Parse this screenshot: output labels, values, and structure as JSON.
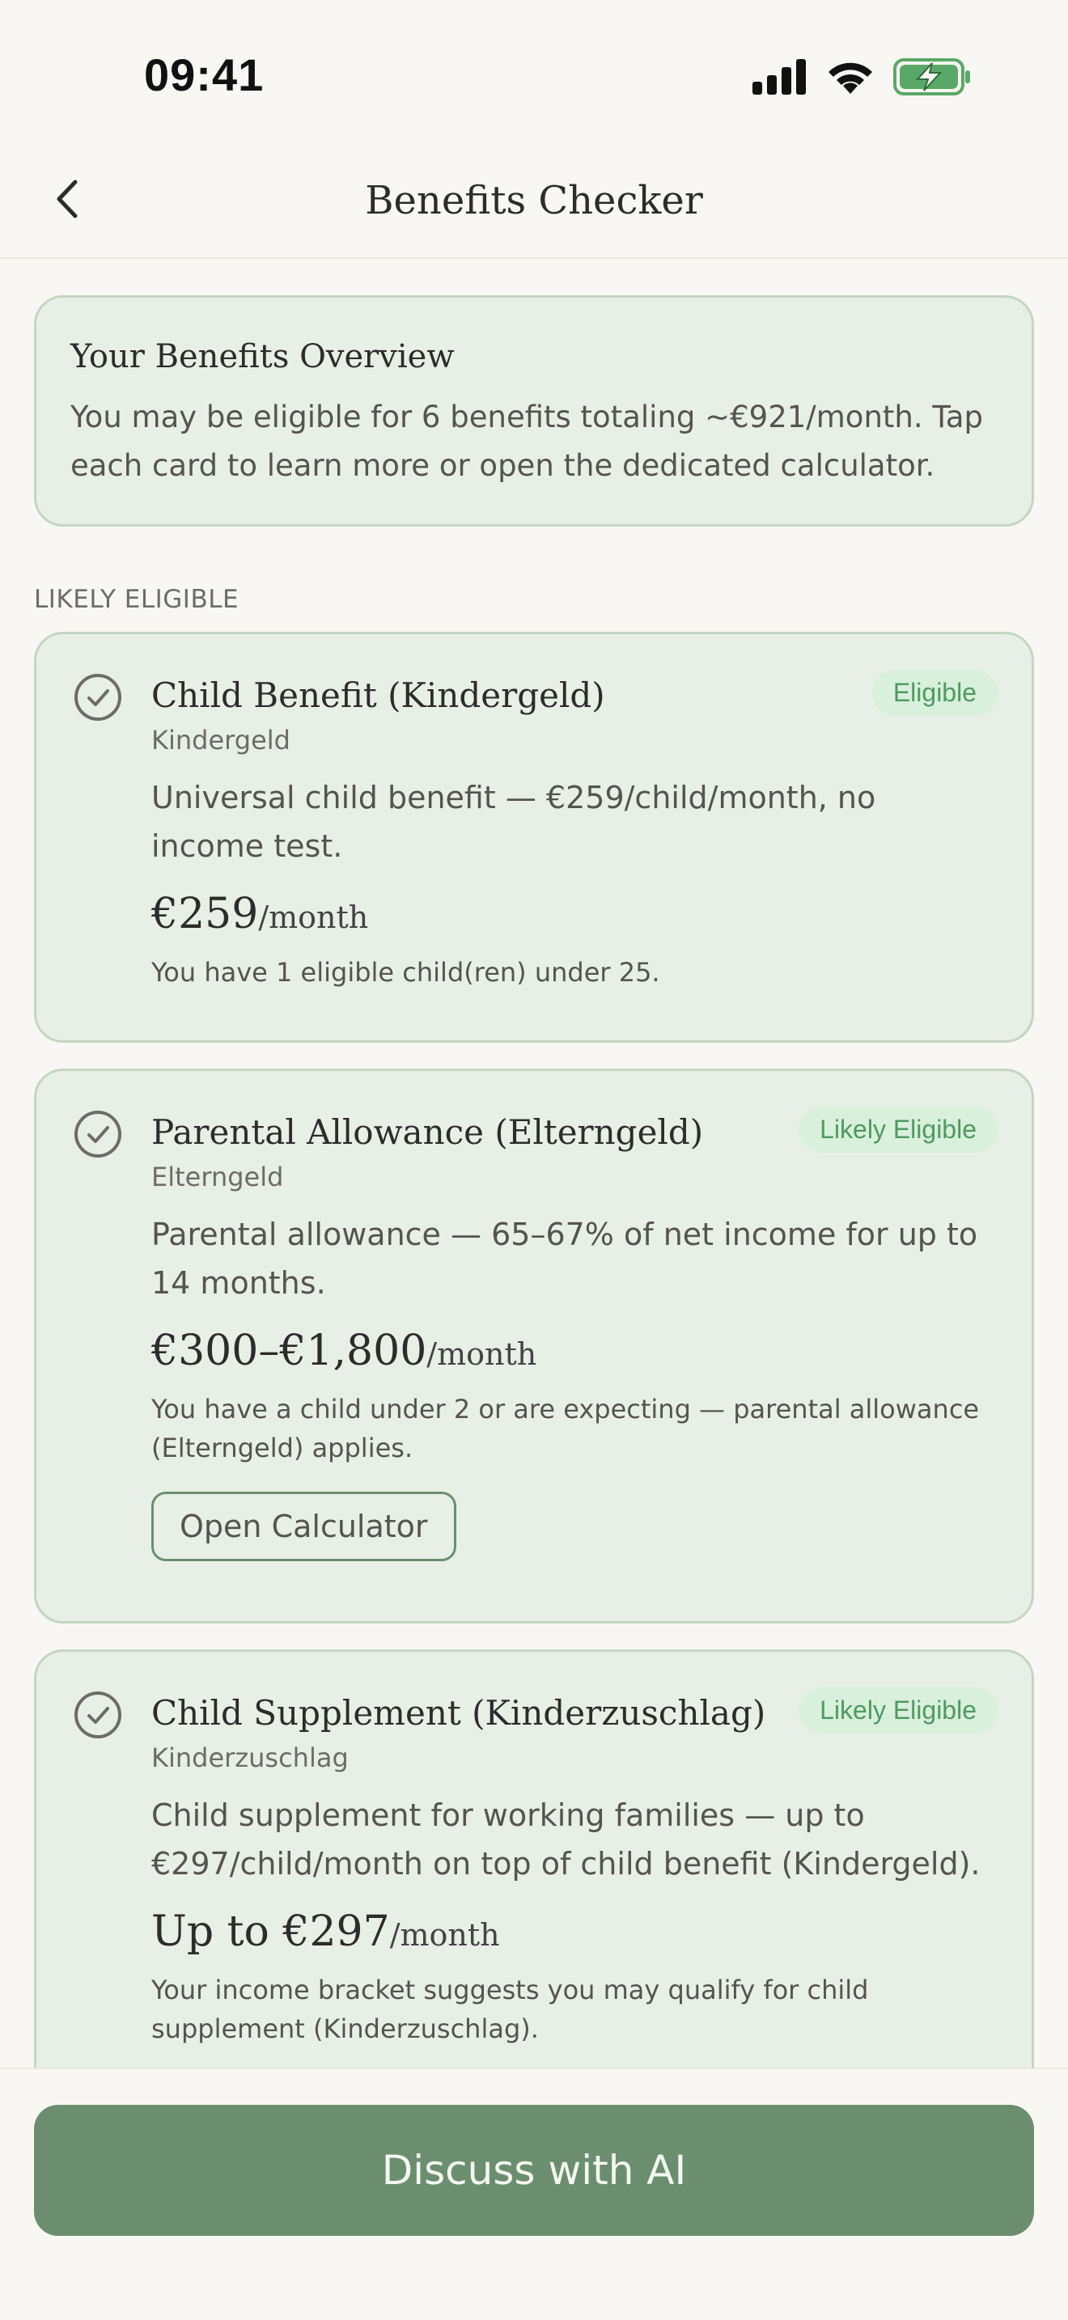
{
  "status": {
    "time": "09:41"
  },
  "nav": {
    "title": "Benefits Checker"
  },
  "overview": {
    "title": "Your Benefits Overview",
    "text": "You may be eligible for 6 benefits totaling ~€921/month. Tap each card to learn more or open the dedicated calculator."
  },
  "section_label": "LIKELY ELIGIBLE",
  "cards": [
    {
      "title": "Child Benefit (Kindergeld)",
      "badge": "Eligible",
      "subtitle": "Kindergeld",
      "description": "Universal child benefit — €259/child/month, no income test.",
      "amount": "€259",
      "unit": "/month",
      "note": "You have 1 eligible child(ren) under 25."
    },
    {
      "title": "Parental Allowance (Elterngeld)",
      "badge": "Likely Eligible",
      "subtitle": "Elterngeld",
      "description": "Parental allowance — 65–67% of net income for up to 14 months.",
      "amount": "€300–€1,800",
      "unit": "/month",
      "note": "You have a child under 2 or are expecting — parental allowance (Elterngeld) applies.",
      "button": "Open Calculator"
    },
    {
      "title": "Child Supplement (Kinderzuschlag)",
      "badge": "Likely Eligible",
      "subtitle": "Kinderzuschlag",
      "description": "Child supplement for working families — up to €297/child/month on top of child benefit (Kindergeld).",
      "amount": "Up to €297",
      "unit": "/month",
      "note": "Your income bracket suggests you may qualify for child supplement (Kinderzuschlag)."
    }
  ],
  "footer": {
    "button": "Discuss with AI"
  },
  "colors": {
    "accent": "#6b8f6e",
    "card_bg": "#e8efe7",
    "badge_bg": "#d8f0dc",
    "badge_text": "#4f9a60"
  },
  "icons": {
    "back": "chevron-left-icon",
    "check": "check-circle-icon"
  }
}
